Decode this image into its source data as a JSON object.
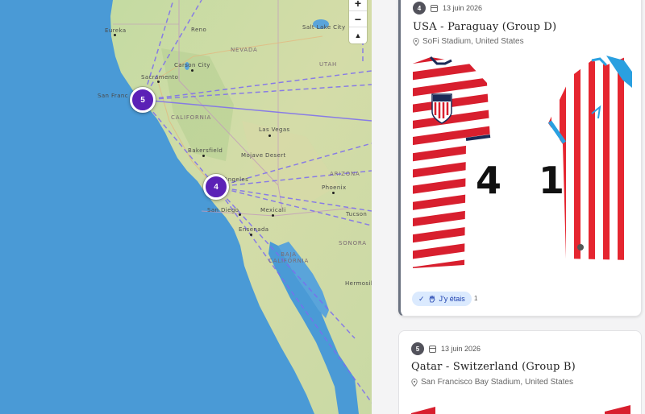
{
  "map": {
    "zoom_in": "+",
    "zoom_out": "−",
    "reset_north": "▲",
    "clusters": [
      {
        "count": "5"
      },
      {
        "count": "4"
      }
    ],
    "labels": {
      "eureka": "Eureka",
      "reno": "Reno",
      "carson_city": "Carson City",
      "sacramento": "Sacramento",
      "san_francisco": "San Franc",
      "salt_lake_city": "Salt Lake City",
      "nevada": "NEVADA",
      "utah": "UTAH",
      "california": "CALIFORNIA",
      "las_vegas": "Las Vegas",
      "bakersfield": "Bakersfield",
      "mojave_desert": "Mojave Desert",
      "arizona": "ARIZONA",
      "los_angeles": "Los Angeles",
      "phoenix": "Phoenix",
      "san_diego": "San Diego",
      "mexicali": "Mexicali",
      "tucson": "Tucson",
      "ensenada": "Ensenada",
      "sonora": "SONORA",
      "baja_california": "BAJA\nCALIFORNIA",
      "hermosillo": "Hermosillo"
    }
  },
  "matches": [
    {
      "number": "4",
      "date": "13 juin 2026",
      "title": "USA - Paraguay (Group D)",
      "venue": "SoFi Stadium, United States",
      "home_score": "4",
      "away_score": "1",
      "attend_label": "J'y étais",
      "attend_count": "1"
    },
    {
      "number": "5",
      "date": "13 juin 2026",
      "title": "Qatar - Switzerland (Group B)",
      "venue": "San Francisco Bay Stadium, United States"
    }
  ],
  "colors": {
    "cluster": "#5b21b6",
    "route": "#7c6cf0",
    "ocean": "#4a9ad6",
    "land": "#c7dca0",
    "attend_bg": "#dbeafe",
    "attend_text": "#1e40af"
  }
}
